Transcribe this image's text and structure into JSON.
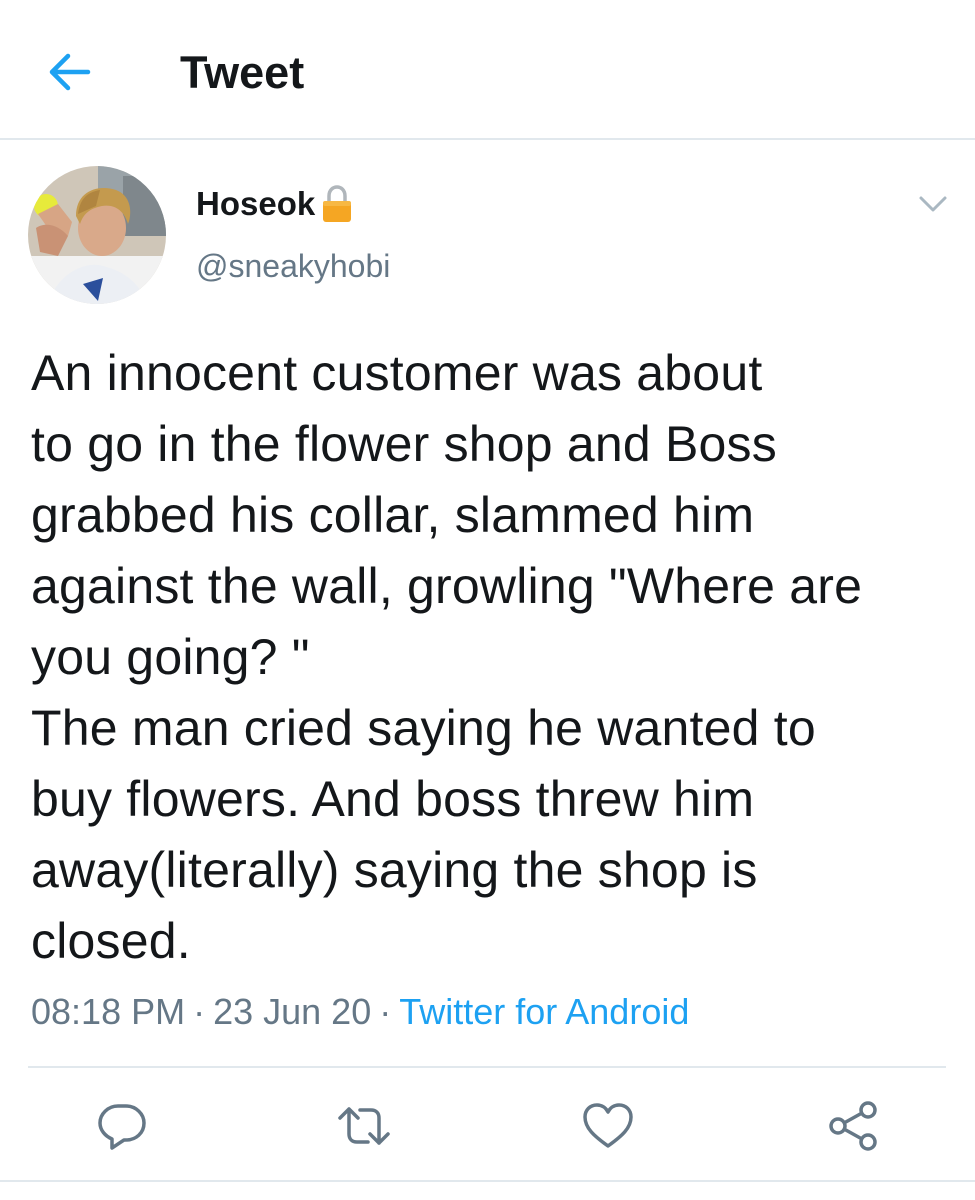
{
  "header": {
    "title": "Tweet",
    "back_icon": "arrow-left-icon"
  },
  "author": {
    "display_name": "Hoseok",
    "handle": "@sneakyhobi",
    "protected_icon": "lock-icon",
    "menu_icon": "chevron-down-icon"
  },
  "tweet": {
    "lines": [
      "An innocent customer was about",
      "to go in the flower shop and Boss",
      "grabbed his collar, slammed him",
      "against the wall, growling \"Where are",
      "you going? \"",
      "The man cried saying he wanted to",
      "buy flowers. And boss threw him",
      "away(literally) saying the shop is",
      "closed."
    ]
  },
  "meta": {
    "time": "08:18 PM",
    "separator": "·",
    "date": "23 Jun 20",
    "source": "Twitter for Android"
  },
  "actions": {
    "reply_icon": "reply-icon",
    "retweet_icon": "retweet-icon",
    "like_icon": "heart-icon",
    "share_icon": "share-icon"
  },
  "colors": {
    "accent": "#1da1f2",
    "text": "#14171a",
    "secondary": "#657786",
    "divider": "#e1e8ed",
    "lock": "#f5a623"
  }
}
